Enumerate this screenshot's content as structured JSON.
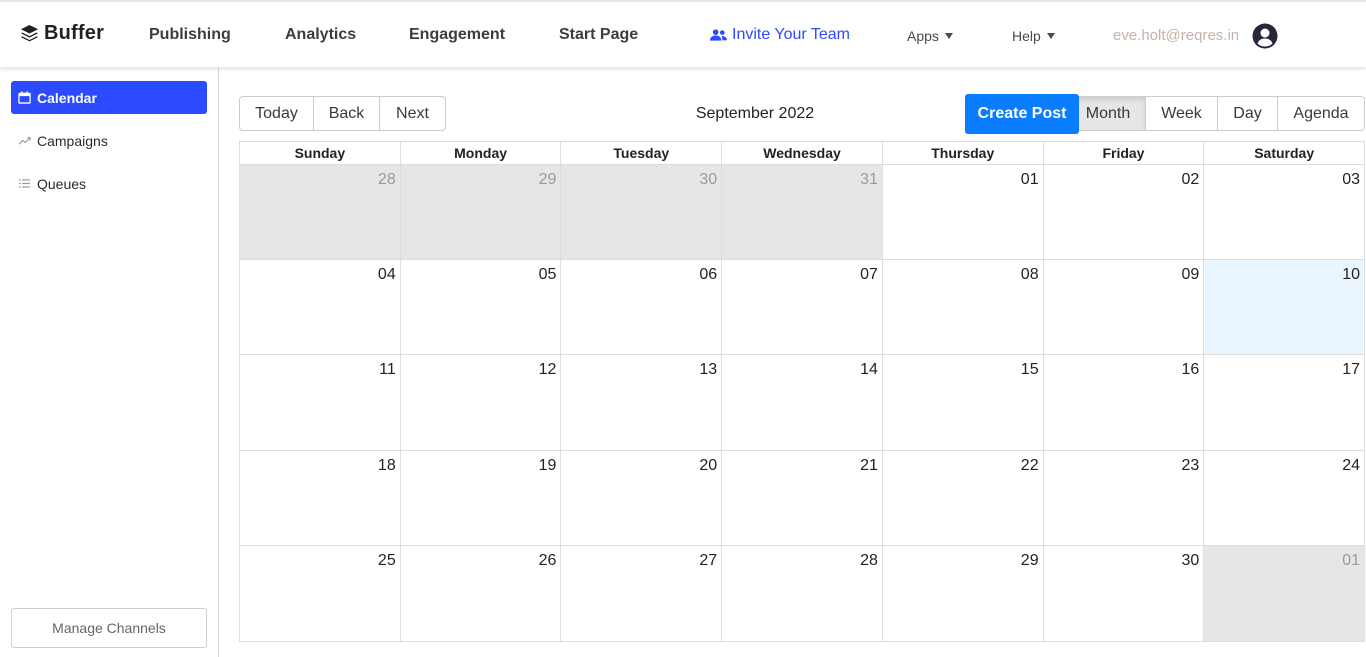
{
  "header": {
    "logo_text": "Buffer",
    "nav": [
      "Publishing",
      "Analytics",
      "Engagement",
      "Start Page"
    ],
    "invite_label": "Invite Your Team",
    "apps_label": "Apps",
    "help_label": "Help",
    "user_email": "eve.holt@reqres.in"
  },
  "sidebar": {
    "items": [
      {
        "label": "Calendar",
        "icon": "calendar-icon",
        "active": true
      },
      {
        "label": "Campaigns",
        "icon": "trend-icon",
        "active": false
      },
      {
        "label": "Queues",
        "icon": "list-icon",
        "active": false
      }
    ],
    "manage_label": "Manage Channels"
  },
  "toolbar": {
    "today": "Today",
    "back": "Back",
    "next": "Next",
    "month_label": "September 2022",
    "create_post": "Create Post",
    "views": [
      "Month",
      "Week",
      "Day",
      "Agenda"
    ],
    "active_view": "Month"
  },
  "calendar": {
    "weekdays": [
      "Sunday",
      "Monday",
      "Tuesday",
      "Wednesday",
      "Thursday",
      "Friday",
      "Saturday"
    ],
    "weeks": [
      [
        {
          "d": "28",
          "off": true
        },
        {
          "d": "29",
          "off": true
        },
        {
          "d": "30",
          "off": true
        },
        {
          "d": "31",
          "off": true
        },
        {
          "d": "01"
        },
        {
          "d": "02"
        },
        {
          "d": "03"
        }
      ],
      [
        {
          "d": "04"
        },
        {
          "d": "05"
        },
        {
          "d": "06"
        },
        {
          "d": "07"
        },
        {
          "d": "08"
        },
        {
          "d": "09"
        },
        {
          "d": "10",
          "today": true
        }
      ],
      [
        {
          "d": "11"
        },
        {
          "d": "12"
        },
        {
          "d": "13"
        },
        {
          "d": "14"
        },
        {
          "d": "15"
        },
        {
          "d": "16"
        },
        {
          "d": "17"
        }
      ],
      [
        {
          "d": "18"
        },
        {
          "d": "19"
        },
        {
          "d": "20"
        },
        {
          "d": "21"
        },
        {
          "d": "22"
        },
        {
          "d": "23"
        },
        {
          "d": "24"
        }
      ],
      [
        {
          "d": "25"
        },
        {
          "d": "26"
        },
        {
          "d": "27"
        },
        {
          "d": "28"
        },
        {
          "d": "29"
        },
        {
          "d": "30"
        },
        {
          "d": "01",
          "off": true
        }
      ]
    ]
  },
  "colors": {
    "accent": "#2c4bff",
    "create_post": "#0a7cff",
    "off_day": "#e6e6e6",
    "today": "#eaf6ff"
  }
}
